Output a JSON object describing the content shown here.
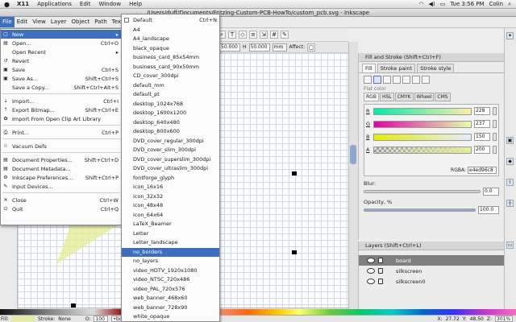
{
  "mac_menu": {
    "apple": "",
    "app": "X11",
    "items": [
      "Applications",
      "Edit",
      "Window",
      "Help"
    ],
    "time": "Tue 3:56 PM",
    "user": "Colin"
  },
  "window": {
    "title": "/Users/duff/Documents/Fritzing-Custom-PCB-HowTo/custom_pcb.svg - Inkscape"
  },
  "menubar": [
    "File",
    "Edit",
    "View",
    "Layer",
    "Object",
    "Path",
    "Text"
  ],
  "toolbar": {
    "text_tool": "T",
    "w_value": "50.000",
    "h_label": "H",
    "h_value": "50.000",
    "unit": "mm",
    "affect": "Affect:"
  },
  "file_menu": [
    {
      "label": "New",
      "shortcut": "",
      "arrow": "▸",
      "highlight": true,
      "icon": "new-icon"
    },
    {
      "label": "Open...",
      "shortcut": "Ctrl+O",
      "icon": "open-icon"
    },
    {
      "label": "Open Recent",
      "shortcut": "",
      "arrow": "▸"
    },
    {
      "label": "Revert",
      "shortcut": "",
      "icon": "revert-icon"
    },
    {
      "label": "Save",
      "shortcut": "Ctrl+S",
      "icon": "save-icon"
    },
    {
      "label": "Save As...",
      "shortcut": "Shift+Ctrl+S",
      "icon": "save-as-icon"
    },
    {
      "label": "Save a Copy...",
      "shortcut": "Shift+Ctrl+Alt+S"
    },
    {
      "label": "Import...",
      "shortcut": "Ctrl+I",
      "icon": "import-icon"
    },
    {
      "label": "Export Bitmap...",
      "shortcut": "Shift+Ctrl+E",
      "icon": "export-icon"
    },
    {
      "label": "Import From Open Clip Art Library",
      "shortcut": "",
      "icon": "clipart-icon"
    },
    {
      "label": "Print...",
      "shortcut": "Ctrl+P",
      "icon": "print-icon"
    },
    {
      "label": "Vacuum Defs",
      "shortcut": "",
      "icon": "vacuum-icon"
    },
    {
      "label": "Document Properties...",
      "shortcut": "Shift+Ctrl+D",
      "icon": "doc-props-icon"
    },
    {
      "label": "Document Metadata...",
      "shortcut": "",
      "icon": "metadata-icon"
    },
    {
      "label": "Inkscape Preferences...",
      "shortcut": "Shift+Ctrl+P",
      "icon": "prefs-icon"
    },
    {
      "label": "Input Devices...",
      "shortcut": "",
      "icon": "input-devices-icon"
    },
    {
      "label": "Close",
      "shortcut": "Ctrl+W",
      "icon": "close-icon"
    },
    {
      "label": "Quit",
      "shortcut": "Ctrl+Q",
      "icon": "quit-icon"
    }
  ],
  "new_submenu": [
    {
      "label": "Default",
      "shortcut": "Ctrl+N"
    },
    {
      "label": "A4"
    },
    {
      "label": "A4_landscape"
    },
    {
      "label": "black_opaque"
    },
    {
      "label": "business_card_85x54mm"
    },
    {
      "label": "business_card_90x50mm"
    },
    {
      "label": "CD_cover_300dpi"
    },
    {
      "label": "default_mm"
    },
    {
      "label": "default_pt"
    },
    {
      "label": "desktop_1024x768"
    },
    {
      "label": "desktop_1600x1200"
    },
    {
      "label": "desktop_640x480"
    },
    {
      "label": "desktop_800x600"
    },
    {
      "label": "DVD_cover_regular_300dpi"
    },
    {
      "label": "DVD_cover_slim_300dpi"
    },
    {
      "label": "DVD_cover_superslim_300dpi"
    },
    {
      "label": "DVD_cover_ultraslim_300dpi"
    },
    {
      "label": "fontforge_glyph"
    },
    {
      "label": "icon_16x16"
    },
    {
      "label": "icon_32x32"
    },
    {
      "label": "icon_48x48"
    },
    {
      "label": "icon_64x64"
    },
    {
      "label": "LaTeX_Beamer"
    },
    {
      "label": "Letter"
    },
    {
      "label": "Letter_landscape"
    },
    {
      "label": "no_borders",
      "highlight": true
    },
    {
      "label": "no_layers"
    },
    {
      "label": "video_HDTV_1920x1080"
    },
    {
      "label": "video_NTSC_720x486"
    },
    {
      "label": "video_PAL_720x576"
    },
    {
      "label": "web_banner_468x60"
    },
    {
      "label": "web_banner_728x90"
    },
    {
      "label": "white_opaque"
    }
  ],
  "fill_stroke": {
    "title": "Fill and Stroke (Shift+Ctrl+F)",
    "tabs": [
      "Fill",
      "Stroke paint",
      "Stroke style"
    ],
    "flat_color": "Flat color",
    "color_tabs": [
      "RGB",
      "HSL",
      "CMYK",
      "Wheel",
      "CMS"
    ],
    "channels": [
      {
        "label": "R",
        "value": "228",
        "from": "#00eda8",
        "to": "#ffeda8"
      },
      {
        "label": "G",
        "value": "237",
        "from": "#e400a8",
        "to": "#e4ffa8"
      },
      {
        "label": "B",
        "value": "150",
        "from": "#e4ed00",
        "to": "#e4edff"
      },
      {
        "label": "A",
        "value": "200",
        "from": "#e4ed9600",
        "to": "#e4ed96"
      }
    ],
    "rgba_label": "RGBA:",
    "rgba_value": "e4ed96c8",
    "blur_label": "Blur:",
    "blur_value": "0.0",
    "opacity_label": "Opacity, %",
    "opacity_value": "100.0"
  },
  "layers": {
    "title": "Layers (Shift+Ctrl+L)",
    "items": [
      {
        "name": "board",
        "selected": true
      },
      {
        "name": "silkscreen"
      },
      {
        "name": "silkscreen0"
      }
    ]
  },
  "status": {
    "fill_label": "Fill:",
    "stroke_label": "Stroke:",
    "stroke_value": "None",
    "opacity_label": "O:",
    "opacity_value": "100",
    "layer_value": "•board",
    "x_label": "X:",
    "x_value": "27.72",
    "y_label": "Y:",
    "y_value": "48.50",
    "zoom_label": "Z:",
    "zoom_value": "301%"
  },
  "colors": {
    "accent": "#3d6fbf",
    "star_fill": "#e4ed96"
  }
}
